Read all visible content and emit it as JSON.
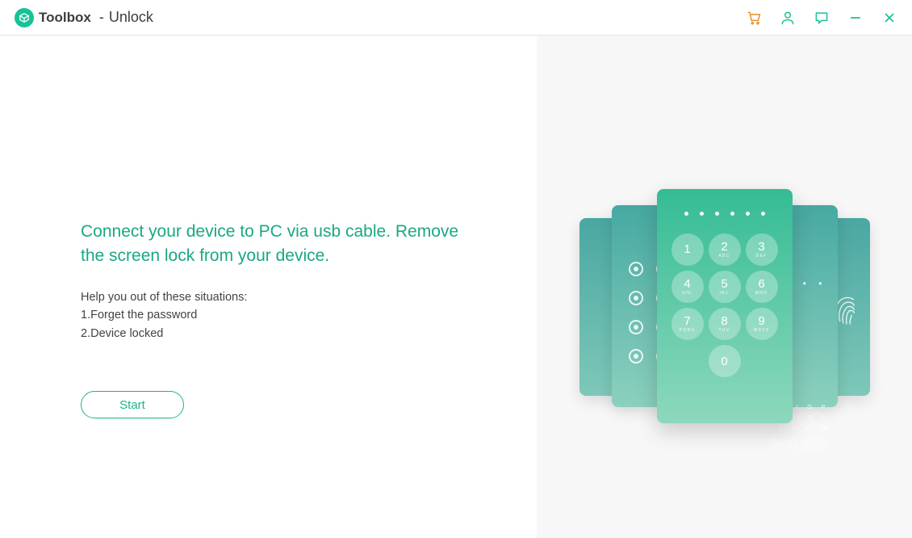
{
  "header": {
    "brand": "Toolbox",
    "separator": "-",
    "page": "Unlock"
  },
  "colors": {
    "accent": "#18c298",
    "cart": "#e9912a"
  },
  "main": {
    "headline": "Connect your device to PC via usb cable. Remove the screen lock from your device.",
    "help_title": "Help you out of these situations:",
    "help_items": [
      "1.Forget the password",
      "2.Device locked"
    ],
    "start_label": "Start"
  },
  "keypad": {
    "dots": 6,
    "keys": [
      {
        "num": "1",
        "sub": ""
      },
      {
        "num": "2",
        "sub": "ABC"
      },
      {
        "num": "3",
        "sub": "DEF"
      },
      {
        "num": "4",
        "sub": "GHI"
      },
      {
        "num": "5",
        "sub": "JKL"
      },
      {
        "num": "6",
        "sub": "MNO"
      },
      {
        "num": "7",
        "sub": "PQRS"
      },
      {
        "num": "8",
        "sub": "TUV"
      },
      {
        "num": "9",
        "sub": "WXYZ"
      }
    ],
    "zero": "0"
  }
}
